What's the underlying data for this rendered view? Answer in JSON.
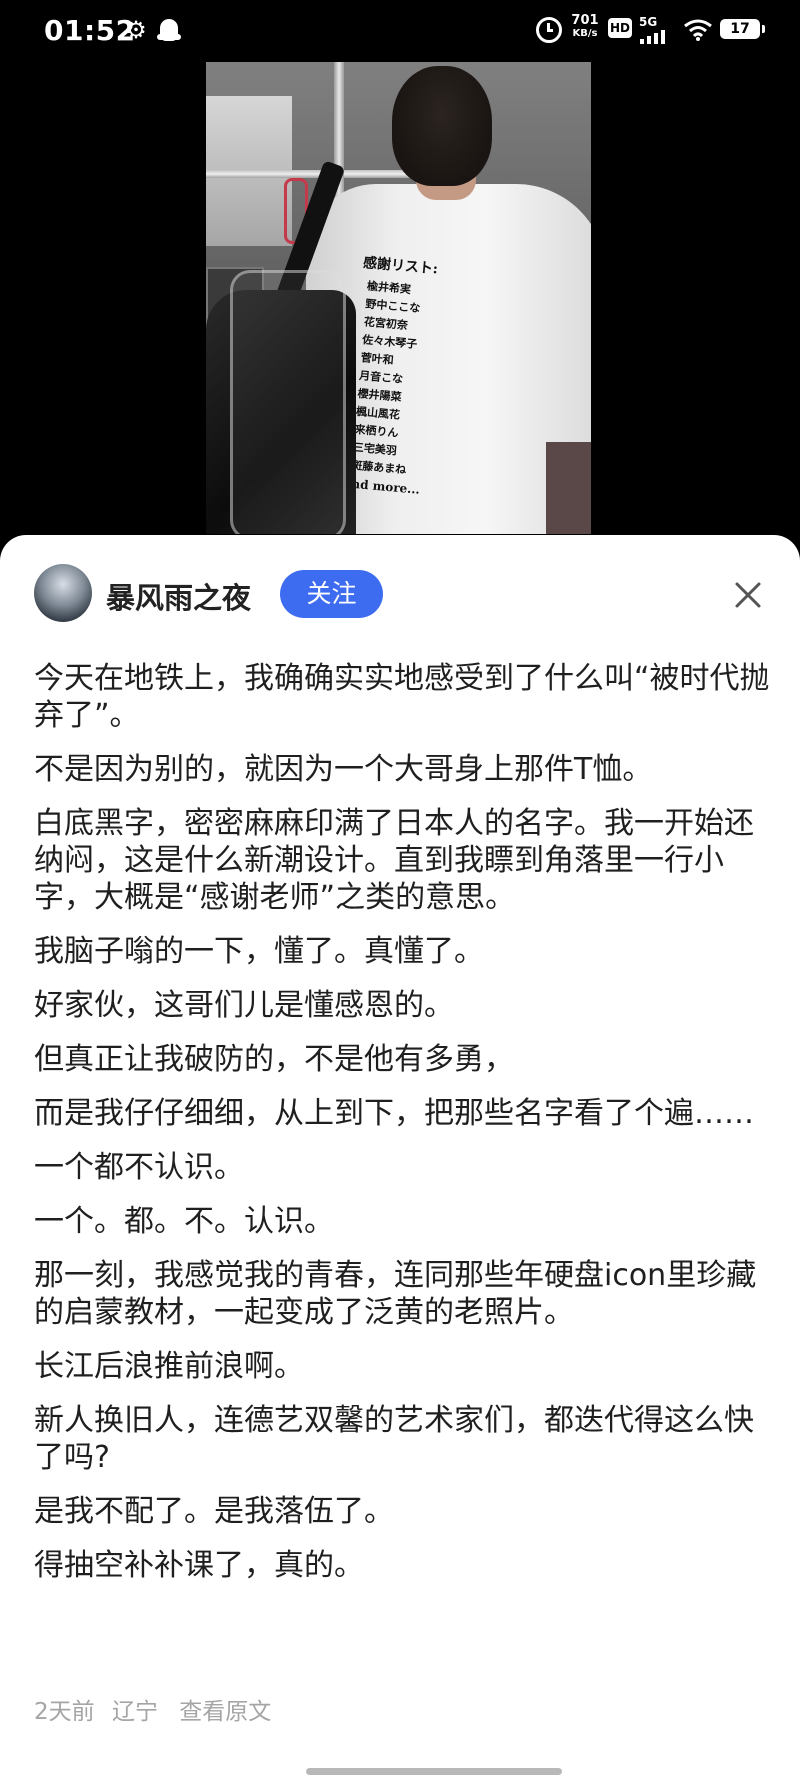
{
  "status_bar": {
    "time": "01:52",
    "gear_icon": "gear-icon",
    "qq_icon": "qq-penguin-icon",
    "alarm_icon": "alarm-icon",
    "net_speed_value": "701",
    "net_speed_unit": "KB/s",
    "hd_label": "HD",
    "signal_label": "5G",
    "battery_level": "17"
  },
  "photo": {
    "shirt_title": "感謝リスト:",
    "shirt_names": [
      "楡井希実",
      "野中ここな",
      "花宮初奈",
      "佐々木琴子",
      "菅叶和",
      "月音こな",
      "櫻井陽菜",
      "楓山風花",
      "来栖りん",
      "三宅美羽",
      "斑藤あまね"
    ],
    "shirt_more": "and more..."
  },
  "post": {
    "author": "暴风雨之夜",
    "follow_label": "关注",
    "paragraphs": [
      "今天在地铁上，我确确实实地感受到了什么叫“被时代抛弃了”。",
      "不是因为别的，就因为一个大哥身上那件T恤。",
      "白底黑字，密密麻麻印满了日本人的名字。我一开始还纳闷，这是什么新潮设计。直到我瞟到角落里一行小字，大概是“感谢老师”之类的意思。",
      "我脑子嗡的一下，懂了。真懂了。",
      "好家伙，这哥们儿是懂感恩的。",
      "但真正让我破防的，不是他有多勇，",
      "而是我仔仔细细，从上到下，把那些名字看了个遍……",
      "一个都不认识。",
      "一个。都。不。认识。",
      "那一刻，我感觉我的青春，连同那些年硬盘icon里珍藏的启蒙教材，一起变成了泛黄的老照片。",
      "长江后浪推前浪啊。",
      "新人换旧人，连德艺双馨的艺术家们，都迭代得这么快了吗?",
      "是我不配了。是我落伍了。",
      "得抽空补补课了，真的。"
    ],
    "time_ago": "2天前",
    "location": "辽宁",
    "view_original": "查看原文"
  },
  "colors": {
    "follow_button": "#3d6cf0",
    "meta_text": "#a5a5a5",
    "body_text": "#1f1f1f"
  }
}
